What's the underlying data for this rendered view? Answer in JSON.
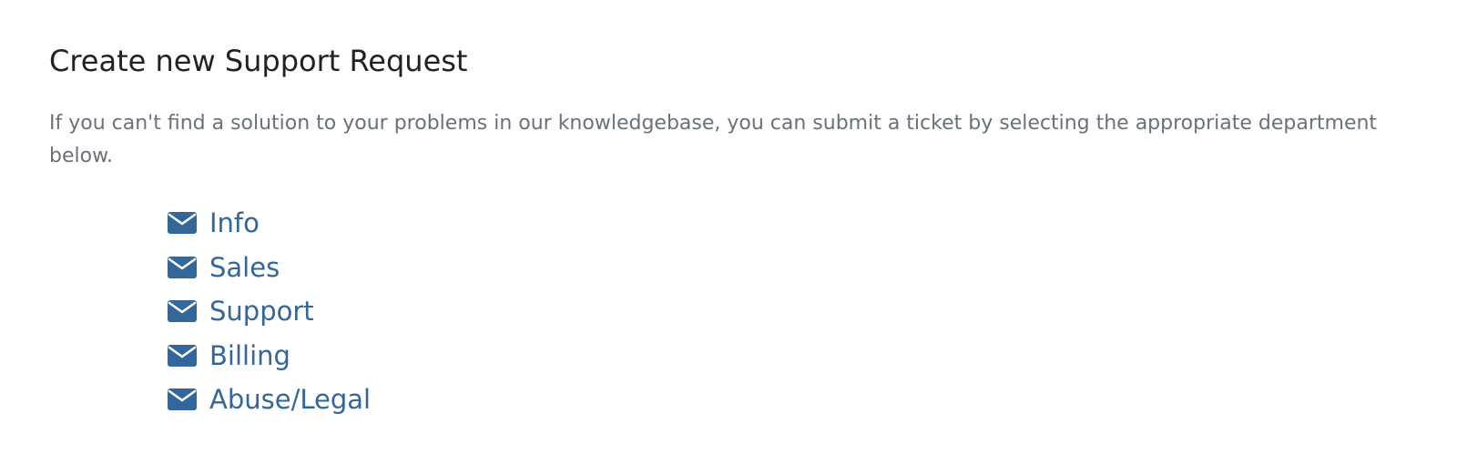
{
  "page": {
    "title": "Create new Support Request",
    "intro": "If you can't find a solution to your problems in our knowledgebase, you can submit a ticket by selecting the appropriate department below."
  },
  "departments": [
    {
      "label": "Info",
      "icon": "envelope-icon"
    },
    {
      "label": "Sales",
      "icon": "envelope-icon"
    },
    {
      "label": "Support",
      "icon": "envelope-icon"
    },
    {
      "label": "Billing",
      "icon": "envelope-icon"
    },
    {
      "label": "Abuse/Legal",
      "icon": "envelope-icon"
    }
  ],
  "colors": {
    "link": "#336699",
    "title": "#222222",
    "intro": "#6b717a"
  }
}
